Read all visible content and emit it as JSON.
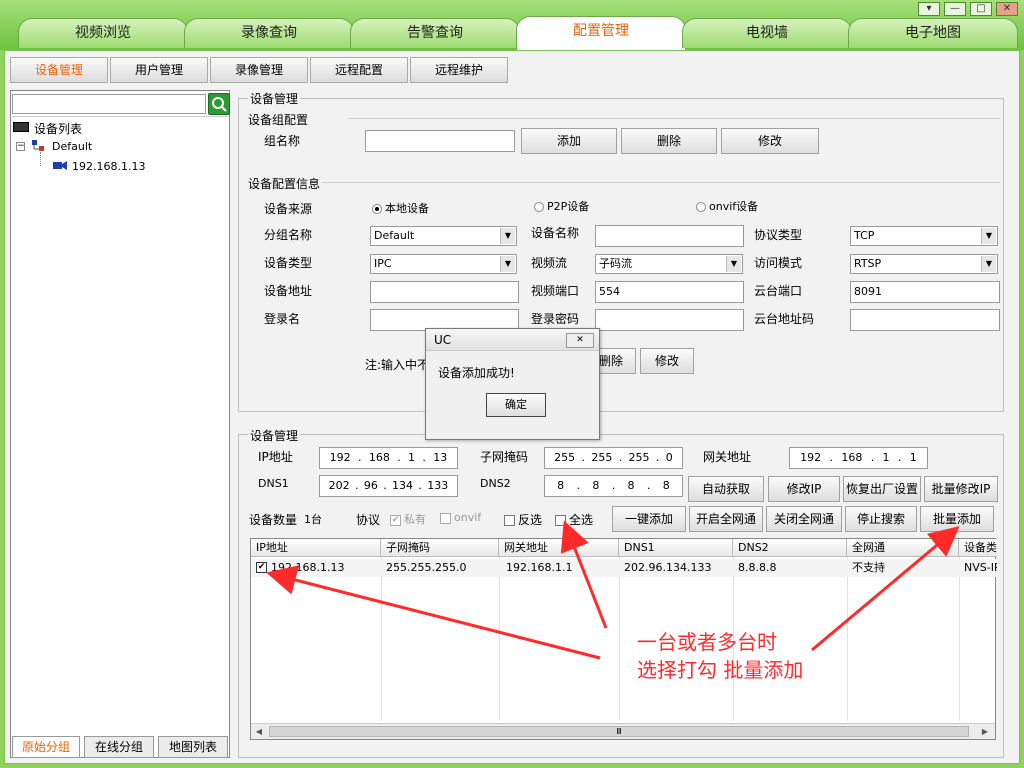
{
  "window_controls": {
    "menu": "▾",
    "minimize": "—",
    "maximize": "□",
    "close": "✕"
  },
  "main_tabs": [
    "视频浏览",
    "录像查询",
    "告警查询",
    "配置管理",
    "电视墙",
    "电子地图"
  ],
  "sub_tabs": [
    "设备管理",
    "用户管理",
    "录像管理",
    "远程配置",
    "远程维护"
  ],
  "left_panel": {
    "search_placeholder": "",
    "tree_root": "设备列表",
    "tree_group": "Default",
    "tree_device": "192.168.1.13",
    "bottom_tabs": [
      "原始分组",
      "在线分组",
      "地图列表"
    ]
  },
  "device_mgmt": {
    "legend": "设备管理",
    "group_section": "设备组配置",
    "group_name_label": "组名称",
    "group_name_value": "",
    "add_button": "添加",
    "delete_button": "删除",
    "modify_button": "修改",
    "config_section": "设备配置信息",
    "source_label": "设备来源",
    "source_local": "本地设备",
    "source_p2p": "P2P设备",
    "source_onvif": "onvif设备",
    "subgroup_label": "分组名称",
    "subgroup_value": "Default",
    "device_name_label": "设备名称",
    "device_name_value": "",
    "protocol_label": "协议类型",
    "protocol_value": "TCP",
    "device_type_label": "设备类型",
    "device_type_value": "IPC",
    "video_stream_label": "视频流",
    "video_stream_value": "子码流",
    "access_mode_label": "访问模式",
    "access_mode_value": "RTSP",
    "device_addr_label": "设备地址",
    "device_addr_value": "",
    "video_port_label": "视频端口",
    "video_port_value": "554",
    "ptz_port_label": "云台端口",
    "ptz_port_value": "8091",
    "login_label": "登录名",
    "login_value": "",
    "password_label": "登录密码",
    "password_value": "",
    "ptz_addr_label": "云台地址码",
    "ptz_addr_value": "",
    "note": "注:输入中不",
    "delete_button2": "删除",
    "modify_button2": "修改"
  },
  "dialog": {
    "title": "UC",
    "close": "✕",
    "message": "设备添加成功!",
    "ok": "确定"
  },
  "network": {
    "legend": "设备管理",
    "ip_label": "IP地址",
    "ip": [
      "192",
      "168",
      "1",
      "13"
    ],
    "mask_label": "子网掩码",
    "mask": [
      "255",
      "255",
      "255",
      "0"
    ],
    "gateway_label": "网关地址",
    "gateway": [
      "192",
      "168",
      "1",
      "1"
    ],
    "dns1_label": "DNS1",
    "dns1": [
      "202",
      "96",
      "134",
      "133"
    ],
    "dns2_label": "DNS2",
    "dns2": [
      "8",
      "8",
      "8",
      "8"
    ],
    "auto_button": "自动获取",
    "modify_ip_button": "修改IP",
    "factory_button": "恢复出厂设置",
    "batch_modify_button": "批量修改IP",
    "count_label": "设备数量",
    "count_value": "1台",
    "protocol_label": "协议",
    "proto_private": "私有",
    "proto_onvif": "onvif",
    "invert_label": "反选",
    "select_all_label": "全选",
    "one_click_add": "一键添加",
    "enable_all": "开启全网通",
    "disable_all": "关闭全网通",
    "stop_search": "停止搜索",
    "batch_add": "批量添加"
  },
  "table": {
    "headers": [
      "IP地址",
      "子网掩码",
      "网关地址",
      "DNS1",
      "DNS2",
      "全网通",
      "设备类"
    ],
    "rows": [
      [
        "192.168.1.13",
        "255.255.255.0",
        "192.168.1.1",
        "202.96.134.133",
        "8.8.8.8",
        "不支持",
        "NVS-IP"
      ]
    ],
    "scroll_grip": "Ⅲ"
  },
  "annotation": {
    "line1": "一台或者多台时",
    "line2": "选择打勾 批量添加"
  },
  "colors": {
    "accent": "#e8640c",
    "annotation": "#ff2a2a",
    "chrome_green": "#8fd35c"
  }
}
